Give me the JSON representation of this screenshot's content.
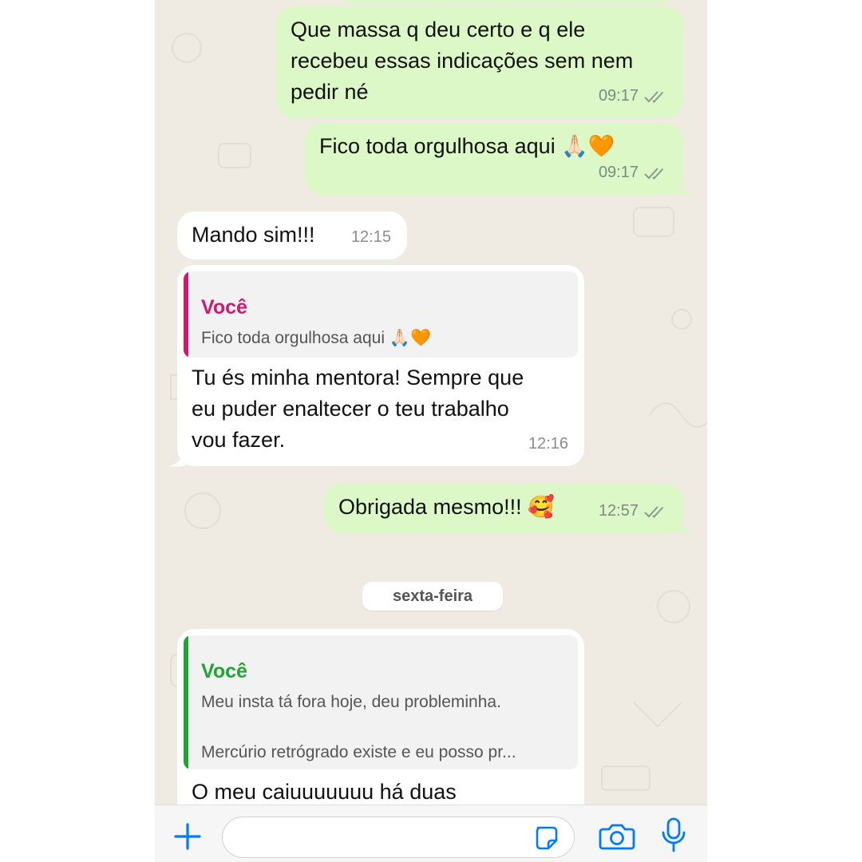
{
  "messages": [
    {
      "id": "m1",
      "direction": "outgoing",
      "lines": [
        "Que massa q deu certo e q ele",
        "recebeu essas indicações sem nem",
        "pedir né"
      ],
      "time": "09:17",
      "status": "read"
    },
    {
      "id": "m2",
      "direction": "outgoing",
      "text": "Fico toda orgulhosa aqui 🙏🏻🧡",
      "time": "09:17",
      "status": "read"
    },
    {
      "id": "m3",
      "direction": "incoming",
      "text": "Mando sim!!!",
      "time": "12:15"
    },
    {
      "id": "m4",
      "direction": "incoming",
      "reply": {
        "author": "Você",
        "text": "Fico toda orgulhosa aqui 🙏🏻🧡"
      },
      "lines": [
        "Tu és minha mentora! Sempre que",
        "eu puder enaltecer o teu trabalho",
        "vou fazer."
      ],
      "time": "12:16"
    },
    {
      "id": "m5",
      "direction": "outgoing",
      "text": "Obrigada mesmo!!! 🥰",
      "time": "12:57",
      "status": "read"
    },
    {
      "id": "m6",
      "direction": "incoming",
      "reply": {
        "author": "Você",
        "line1": "Meu insta tá fora hoje, deu probleminha.",
        "line2": "Mercúrio retrógrado existe e eu posso pr..."
      },
      "text_partial": "O meu caiuuuuuuu há duas"
    }
  ],
  "day_divider": "sexta-feira",
  "colors": {
    "outgoing_bubble": "#dcf8c6",
    "incoming_bubble": "#ffffff",
    "reply_author_pink": "#d0186e",
    "reply_author_green": "#1fa533",
    "accent_blue": "#007aff",
    "background": "#efeae2"
  },
  "input_bar": {
    "left_icon": "plus-icon",
    "sticker_icon": "sticker-icon",
    "camera_icon": "camera-icon",
    "mic_icon": "microphone-icon"
  }
}
